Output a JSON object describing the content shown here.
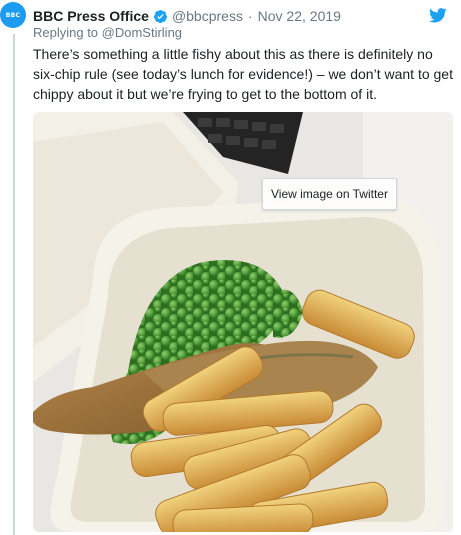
{
  "tweet": {
    "avatar_text": "BBC",
    "author_name": "BBC Press Office",
    "handle": "@bbcpress",
    "separator": "·",
    "date": "Nov 22, 2019",
    "reply_to": "Replying to @DomStirling",
    "text": "There’s something a little fishy about this as there is definitely no six-chip rule (see today’s lunch for evidence!) – we don’t want to get chippy about it but we’re frying to get to the bottom of it.",
    "view_image_label": "View image on Twitter"
  },
  "colors": {
    "accent": "#1da1f2",
    "muted_text": "#697882",
    "body_text": "#1c2022",
    "thread_line": "#ccd6dd"
  },
  "icons": {
    "verified": "verified-badge-icon",
    "platform": "twitter-bird-icon"
  }
}
